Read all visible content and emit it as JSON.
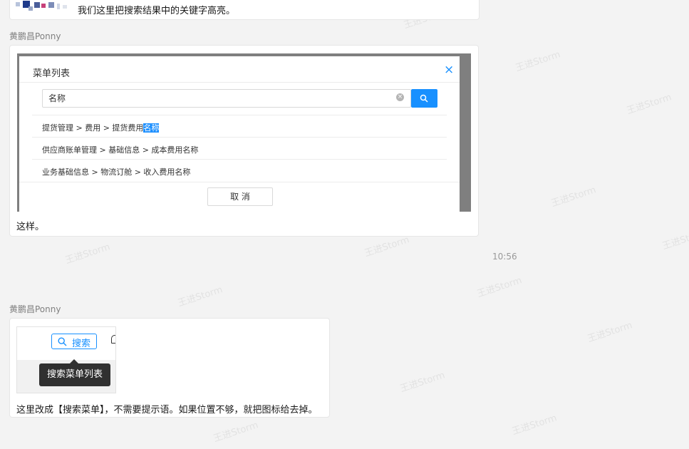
{
  "watermark": "王进Storm",
  "message1": {
    "text": "我们这里把搜索结果中的关键字高亮。"
  },
  "message2": {
    "sender": "黄鹏昌Ponny",
    "screenshot": {
      "dialog_title": "菜单列表",
      "close_icon": "×",
      "search_value": "名称",
      "results": [
        {
          "prefix": "提货管理 > 费用 > 提货费用",
          "highlight": "名称"
        },
        {
          "prefix": "供应商账单管理 > 基础信息 > 成本费用名称",
          "highlight": ""
        },
        {
          "prefix": "业务基础信息 > 物流订舱 > 收入费用名称",
          "highlight": ""
        }
      ],
      "cancel_label": "取 消"
    },
    "text": "这样。"
  },
  "timestamp": "10:56",
  "message3": {
    "sender": "黄鹏昌Ponny",
    "screenshot": {
      "search_button_label": "搜索",
      "tooltip": "搜索菜单列表"
    },
    "text": "这里改成【搜索菜单】，不需要提示语。如果位置不够，就把图标给去掉。"
  },
  "colors": {
    "accent": "#1890ff",
    "highlight": "#1e90ff",
    "tooltip_bg": "#303030"
  }
}
